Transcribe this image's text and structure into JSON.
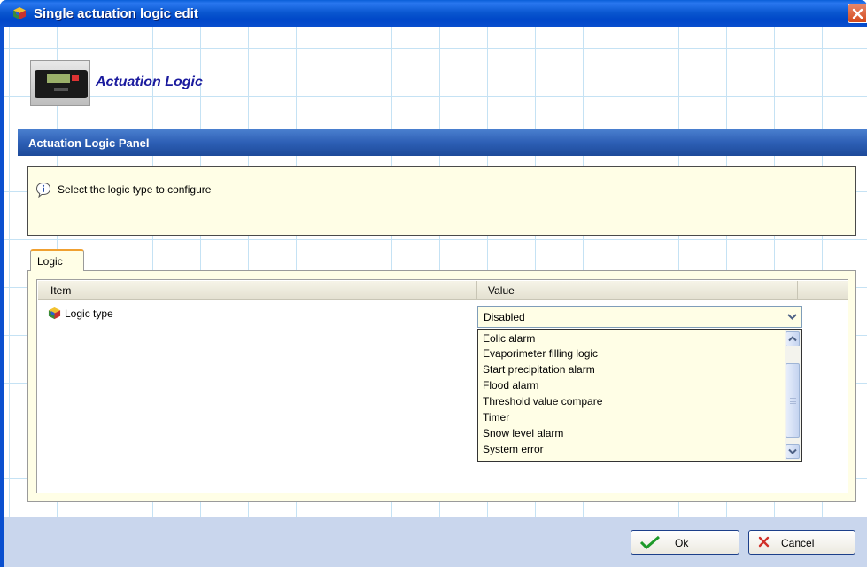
{
  "window": {
    "title": "Single actuation logic edit",
    "close_icon": "close-icon",
    "accent": "#0a4fcf"
  },
  "banner": {
    "title": "Actuation Logic",
    "image": "datalogger-device-icon"
  },
  "panel": {
    "header": "Actuation Logic Panel",
    "info_text": "Select the logic type to configure",
    "info_icon": "info-icon"
  },
  "tabs": [
    {
      "label": "Logic",
      "selected": true
    }
  ],
  "grid": {
    "columns": [
      "Item",
      "Value"
    ],
    "rows": [
      {
        "item": "Logic type",
        "value": "Disabled",
        "icon": "cube-icon"
      }
    ]
  },
  "dropdown": {
    "options": [
      "Eolic alarm",
      "Evaporimeter filling logic",
      "Start precipitation alarm",
      "Flood alarm",
      "Threshold value compare",
      "Timer",
      "Snow level alarm",
      "System error"
    ]
  },
  "buttons": {
    "ok_first": "O",
    "ok_rest": "k",
    "cancel_first": "C",
    "cancel_rest": "ancel"
  }
}
